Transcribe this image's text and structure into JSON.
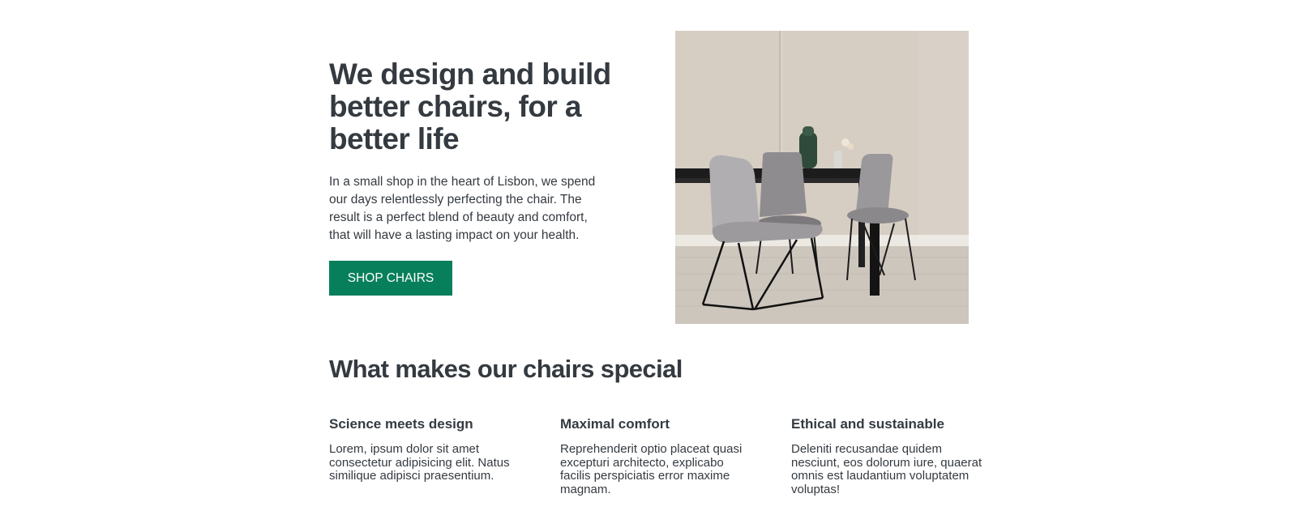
{
  "hero": {
    "title": "We design and build better chairs, for a better life",
    "description": "In a small shop in the heart of Lisbon, we spend our days relentlessly perfecting the chair. The result is a perfect blend of beauty and comfort, that will have a lasting impact on your health.",
    "cta_label": "SHOP CHAIRS",
    "image_name": "dining-chairs-photo"
  },
  "features": {
    "title": "What makes our chairs special",
    "items": [
      {
        "title": "Science meets design",
        "text": "Lorem, ipsum dolor sit amet consectetur adipisicing elit. Natus similique adipisci praesentium."
      },
      {
        "title": "Maximal comfort",
        "text": "Reprehenderit optio placeat quasi excepturi architecto, explicabo facilis perspiciatis error maxime magnam."
      },
      {
        "title": "Ethical and sustainable",
        "text": "Deleniti recusandae quidem nesciunt, eos dolorum iure, quaerat omnis est laudantium voluptatem voluptas!"
      }
    ]
  },
  "colors": {
    "accent": "#087f5b",
    "text": "#343a40"
  }
}
